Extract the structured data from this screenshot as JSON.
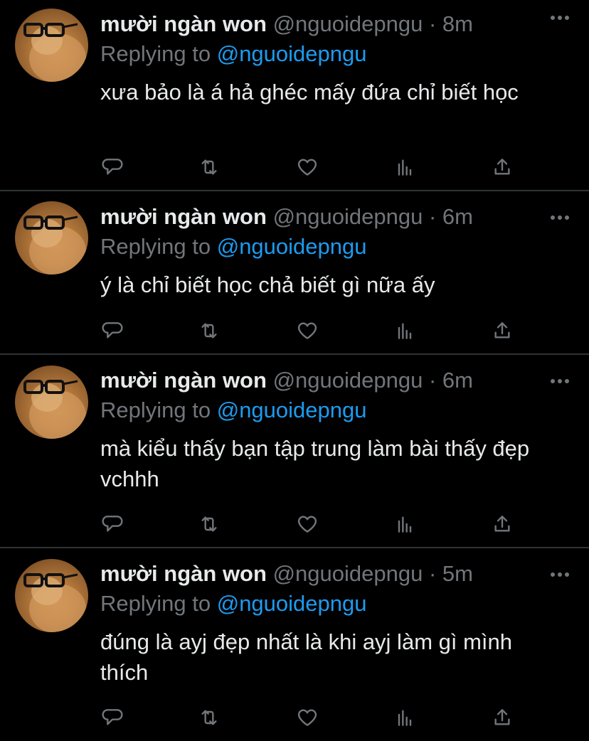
{
  "colors": {
    "background": "#000000",
    "text": "#e7e9ea",
    "muted": "#71767b",
    "accent": "#1d9bf0",
    "divider": "#2f3336"
  },
  "tweets": [
    {
      "name": "mười ngàn won",
      "handle": "@nguoidepngu",
      "separator": "·",
      "time": "8m",
      "replying_prefix": "Replying to ",
      "replying_handle": "@nguoidepngu",
      "text": "xưa bảo là á hả ghéc mấy đứa chỉ biết học",
      "icons": [
        "avatar",
        "more-icon",
        "reply-icon",
        "retweet-icon",
        "like-icon",
        "analytics-icon",
        "share-icon"
      ]
    },
    {
      "name": "mười ngàn won",
      "handle": "@nguoidepngu",
      "separator": "·",
      "time": "6m",
      "replying_prefix": "Replying to ",
      "replying_handle": "@nguoidepngu",
      "text": "ý là chỉ biết học chả biết gì nữa ấy",
      "icons": [
        "avatar",
        "more-icon",
        "reply-icon",
        "retweet-icon",
        "like-icon",
        "analytics-icon",
        "share-icon"
      ]
    },
    {
      "name": "mười ngàn won",
      "handle": "@nguoidepngu",
      "separator": "·",
      "time": "6m",
      "replying_prefix": "Replying to ",
      "replying_handle": "@nguoidepngu",
      "text": "mà kiểu thấy bạn tập trung làm bài thấy đẹp vchhh",
      "icons": [
        "avatar",
        "more-icon",
        "reply-icon",
        "retweet-icon",
        "like-icon",
        "analytics-icon",
        "share-icon"
      ]
    },
    {
      "name": "mười ngàn won",
      "handle": "@nguoidepngu",
      "separator": "·",
      "time": "5m",
      "replying_prefix": "Replying to ",
      "replying_handle": "@nguoidepngu",
      "text": "đúng là ayj đẹp nhất là khi ayj làm gì mình thích",
      "icons": [
        "avatar",
        "more-icon",
        "reply-icon",
        "retweet-icon",
        "like-icon",
        "analytics-icon",
        "share-icon"
      ]
    }
  ]
}
